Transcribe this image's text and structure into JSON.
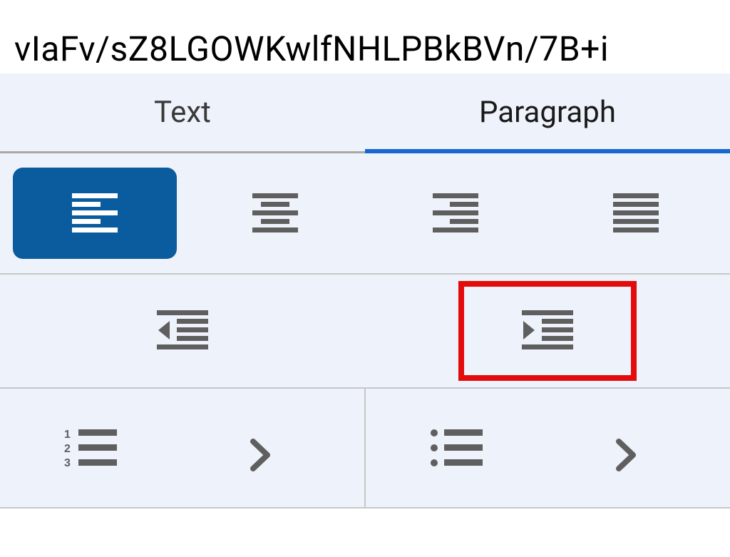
{
  "header": {
    "text": "vIaFv/sZ8LGOWKwlfNHLPBkBVn/7B+i"
  },
  "tabs": {
    "text_label": "Text",
    "paragraph_label": "Paragraph"
  },
  "colors": {
    "selected_bg": "#0a5c9e",
    "accent": "#1768d1",
    "icon": "#5f5f5f",
    "icon_selected": "#ffffff",
    "highlight": "#e30b0b"
  }
}
